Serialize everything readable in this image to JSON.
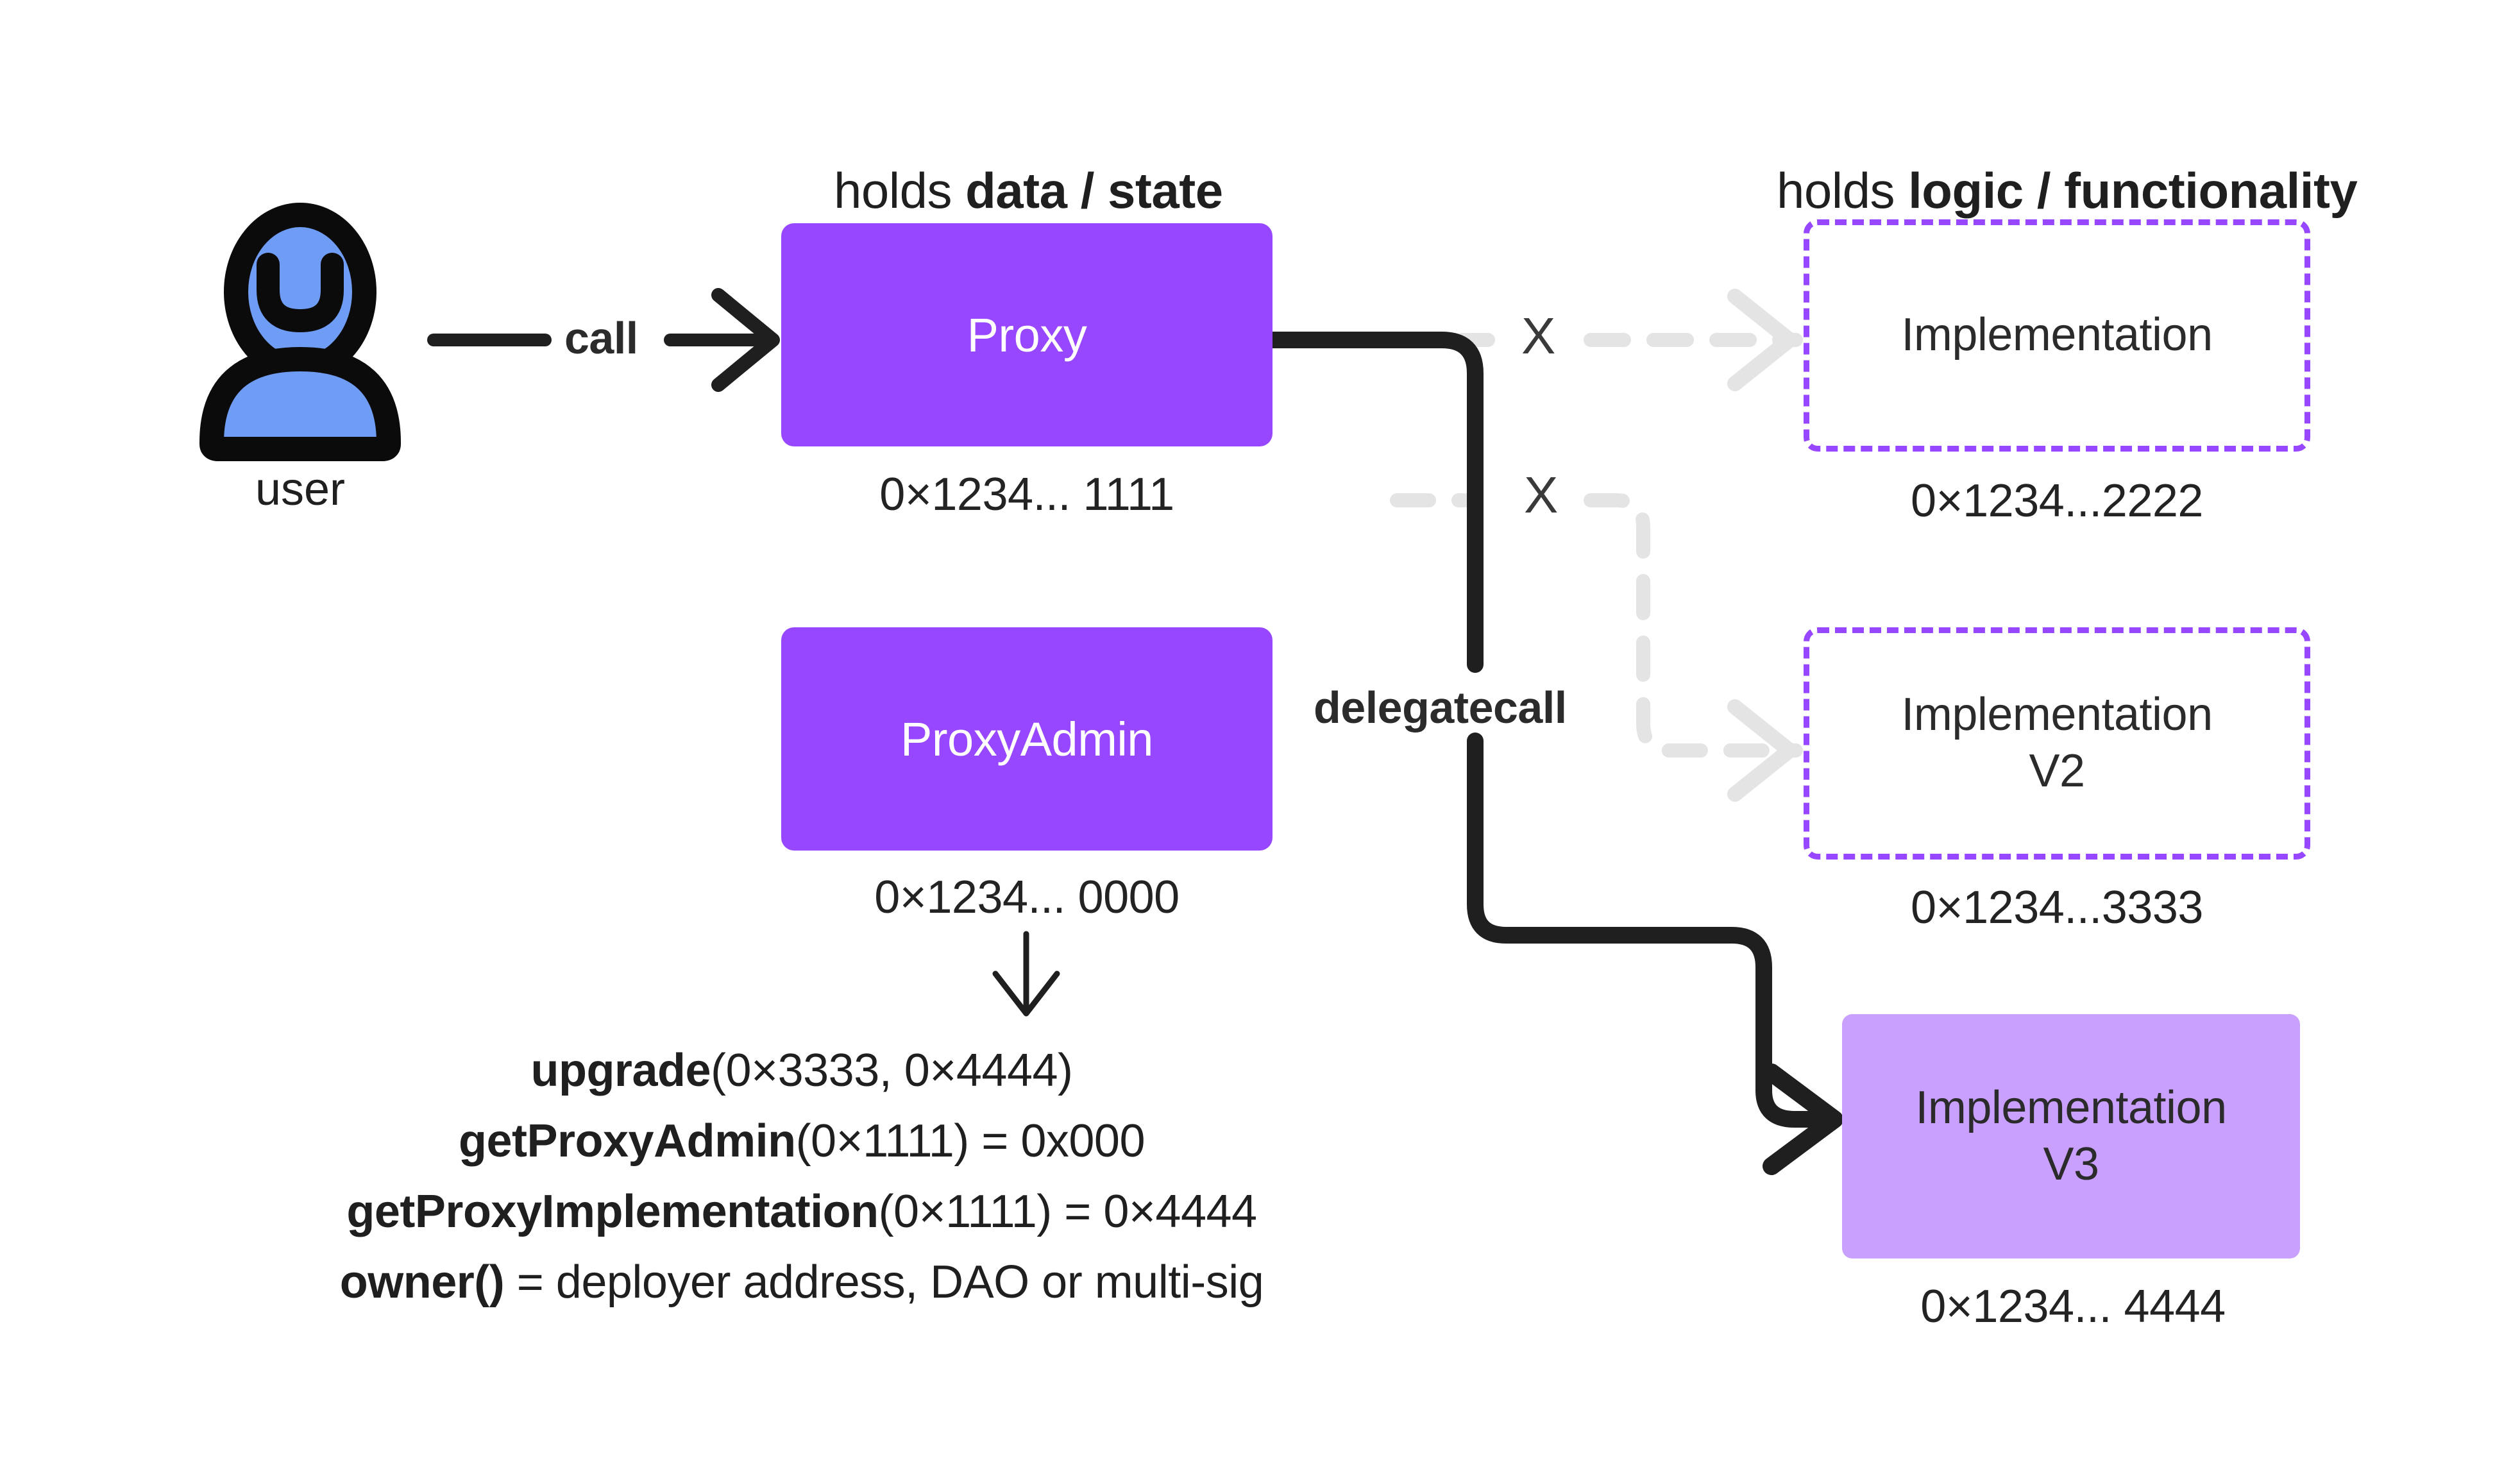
{
  "diagram": {
    "title_left": {
      "light": "holds ",
      "bold": "data / state"
    },
    "title_right": {
      "light": "holds ",
      "bold": "logic / functionality"
    },
    "actor": {
      "icon": "user-avatar-icon",
      "caption": "user"
    },
    "edges": {
      "call_label": "call",
      "delegatecall_label": "delegatecall",
      "x_mark_1": "X",
      "x_mark_2": "X"
    },
    "nodes": [
      {
        "id": "proxy",
        "label": "Proxy",
        "address": "0×1234... 1111",
        "style": "solid-purple"
      },
      {
        "id": "proxy-admin",
        "label": "ProxyAdmin",
        "address": "0×1234... 0000",
        "style": "solid-purple"
      },
      {
        "id": "implementation",
        "label": "Implementation",
        "address": "0×1234...2222",
        "style": "dashed-purple"
      },
      {
        "id": "implementation-v2",
        "label_line1": "Implementation",
        "label_line2": "V2",
        "address": "0×1234...3333",
        "style": "dashed-purple"
      },
      {
        "id": "implementation-v3",
        "label_line1": "Implementation",
        "label_line2": "V3",
        "address": "0×1234... 4444",
        "style": "solid-light-purple"
      }
    ],
    "functions": [
      {
        "name": "upgrade",
        "rest": "(0×3333, 0×4444)"
      },
      {
        "name": "getProxyAdmin",
        "rest": "(0×1111) = 0x000"
      },
      {
        "name": "getProxyImplementation",
        "rest": "(0×1111) = 0×4444"
      },
      {
        "name": "owner()",
        "rest": " = deployer address, DAO or multi-sig"
      }
    ],
    "colors": {
      "purple_solid": "#9747ff",
      "purple_light": "#c9a0fd",
      "purple_dashed_border": "#9747ff",
      "avatar_blue": "#6f9df5",
      "line_black": "#1f1f1f",
      "line_gray": "#e4e4e4",
      "background": "#ffffff"
    }
  }
}
